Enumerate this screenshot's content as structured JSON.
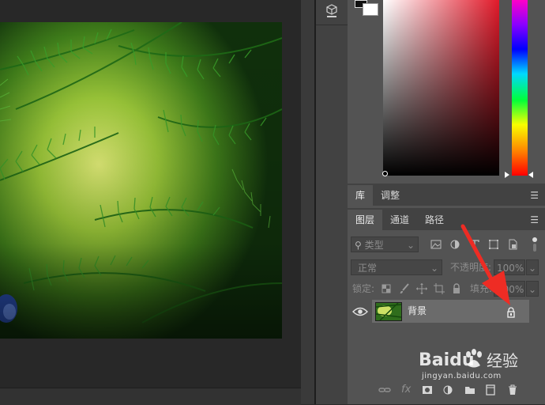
{
  "colors": {
    "canvas_bg": "#282828",
    "panel_bg": "#535353",
    "tabbar_bg": "#424242",
    "layer_selected": "#636363",
    "arrow": "#ee2c24"
  },
  "libraries_panel": {
    "tabs": [
      {
        "label": "库"
      },
      {
        "label": "调整"
      }
    ]
  },
  "layers_panel": {
    "tabs": [
      {
        "label": "图层"
      },
      {
        "label": "通道"
      },
      {
        "label": "路径"
      }
    ],
    "filter": {
      "label": "类型"
    },
    "blend_mode": "正常",
    "opacity": {
      "label": "不透明度:",
      "value": "100%"
    },
    "lock": {
      "label": "锁定:"
    },
    "fill": {
      "label": "填充:",
      "value": "100%"
    },
    "layers": [
      {
        "name": "背景",
        "visible": true,
        "locked": true
      }
    ],
    "footer": {
      "fx_label": "fx"
    }
  },
  "watermark": {
    "brand": "Baidu",
    "cn": "经验",
    "url": "jingyan.baidu.com"
  }
}
